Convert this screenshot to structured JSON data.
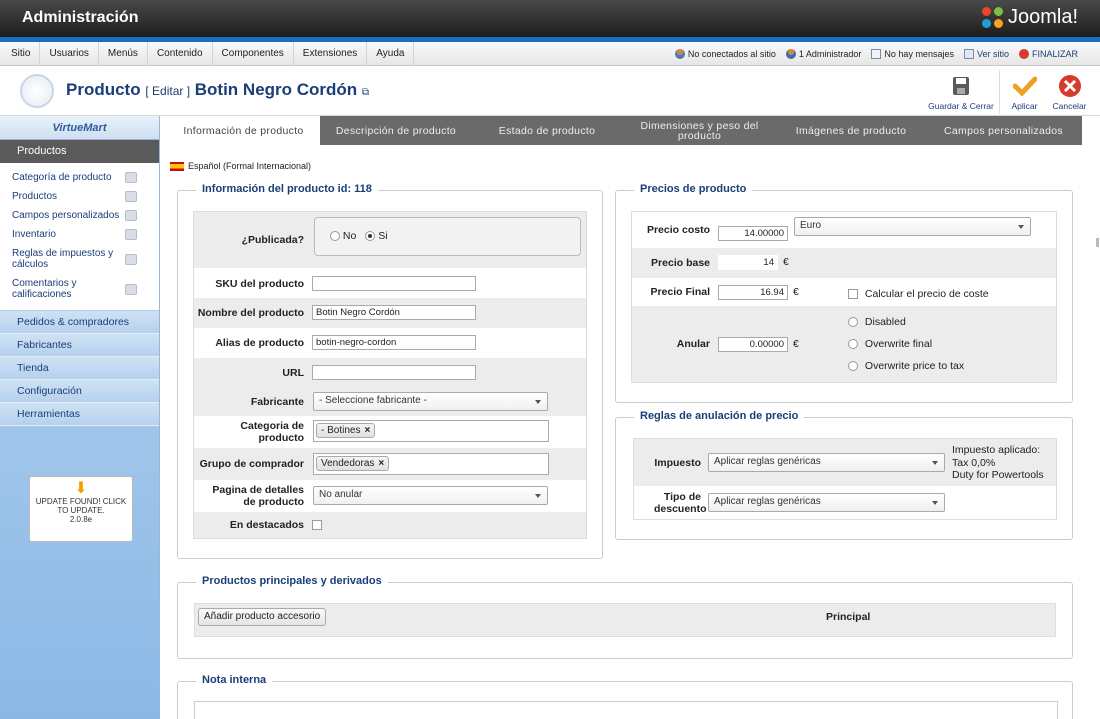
{
  "admin": {
    "title": "Administración",
    "brand": "Joomla!"
  },
  "menu": {
    "items": [
      "Sitio",
      "Usuarios",
      "Menús",
      "Contenido",
      "Componentes",
      "Extensiones",
      "Ayuda"
    ],
    "status": {
      "visitors": "No conectados al sitio",
      "admins": "1 Administrador",
      "messages": "No hay mensajes",
      "view_site": "Ver sitio",
      "logout": "FINALIZAR"
    }
  },
  "header": {
    "title": "Producto",
    "action": "[ Editar ]",
    "product_name": "Botin Negro Cordón",
    "toolbar": {
      "save_close": "Guardar & Cerrar",
      "apply": "Aplicar",
      "cancel": "Cancelar"
    }
  },
  "sidebar": {
    "brand": "VirtueMart",
    "active_section": "Productos",
    "sub_items": [
      "Categoría de producto",
      "Productos",
      "Campos personalizados",
      "Inventario",
      "Reglas de impuestos y cálculos",
      "Comentarios y calificaciones"
    ],
    "sections": [
      "Pedidos & compradores",
      "Fabricantes",
      "Tienda",
      "Configuración",
      "Herramientas"
    ],
    "update": {
      "text": "UPDATE FOUND! CLICK TO UPDATE.",
      "version": "2.0.8e"
    }
  },
  "tabs": [
    "Información de producto",
    "Descripción de producto",
    "Estado de producto",
    "Dimensiones y peso del producto",
    "Imágenes de producto",
    "Campos personalizados"
  ],
  "language": "Español (Formal Internacional)",
  "info": {
    "legend": "Información del producto id: 118",
    "published_label": "¿Publicada?",
    "published_no": "No",
    "published_yes": "Si",
    "sku_label": "SKU del producto",
    "sku_value": "",
    "name_label": "Nombre del producto",
    "name_value": "Botin Negro Cordón",
    "alias_label": "Alias de producto",
    "alias_value": "botin-negro-cordon",
    "url_label": "URL",
    "url_value": "",
    "manufacturer_label": "Fabricante",
    "manufacturer_value": "- Seleccione fabricante -",
    "category_label": "Categoria de producto",
    "category_chip": "- Botines",
    "group_label": "Grupo de comprador",
    "group_chip": "Vendedoras",
    "details_label": "Pagina de detalles de producto",
    "details_value": "No anular",
    "featured_label": "En destacados"
  },
  "prices": {
    "legend": "Precios de producto",
    "cost_label": "Precio costo",
    "cost_value": "14.00000",
    "currency": "Euro",
    "base_label": "Precio base",
    "base_value": "14",
    "final_label": "Precio Final",
    "final_value": "16.94",
    "calc_cost": "Calcular el precio de coste",
    "override_label": "Anular",
    "override_value": "0.00000",
    "euro_symbol": "€",
    "opt_disabled": "Disabled",
    "opt_final": "Overwrite final",
    "opt_tax": "Overwrite price to tax"
  },
  "rules": {
    "legend": "Reglas de anulación de precio",
    "tax_label": "Impuesto",
    "tax_value": "Aplicar reglas genéricas",
    "tax_applied": "Impuesto aplicado:",
    "tax_rate": "Tax 0,0%",
    "tax_duty": "Duty for Powertools",
    "discount_label": "Tipo de descuento",
    "discount_value": "Aplicar reglas genéricas"
  },
  "related": {
    "legend": "Productos principales y derivados",
    "add_button": "Añadir producto accesorio",
    "principal": "Principal"
  },
  "note": {
    "legend": "Nota interna"
  },
  "colors": {
    "accent_blue": "#1a6ec2",
    "title_blue": "#1a3e78",
    "tab_gray": "#6a6a6a"
  }
}
